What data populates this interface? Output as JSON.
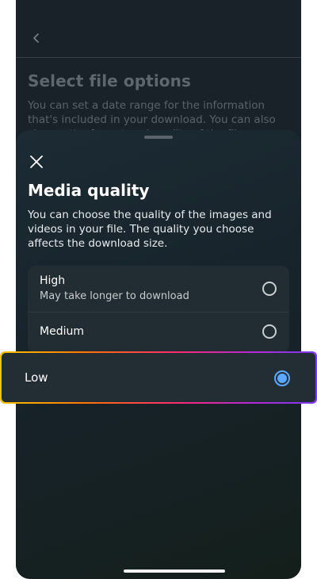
{
  "background_page": {
    "title": "Select file options",
    "description": "You can set a date range for the information that's included in your download. You can also choose the format and quality of the file."
  },
  "sheet": {
    "title": "Media quality",
    "description": "You can choose the quality of the images and videos in your file. The quality you choose affects the download size.",
    "options": [
      {
        "label": "High",
        "sublabel": "May take longer to download",
        "selected": false
      },
      {
        "label": "Medium",
        "sublabel": "",
        "selected": false
      },
      {
        "label": "Low",
        "sublabel": "",
        "selected": true
      }
    ]
  },
  "icons": {
    "back": "chevron-left-icon",
    "close": "close-icon"
  },
  "colors": {
    "accent": "#5aa8ff",
    "highlight_gradient": [
      "#f5c400",
      "#ff7a00",
      "#ff2a6d",
      "#b12ad8",
      "#7a3bf2"
    ]
  }
}
